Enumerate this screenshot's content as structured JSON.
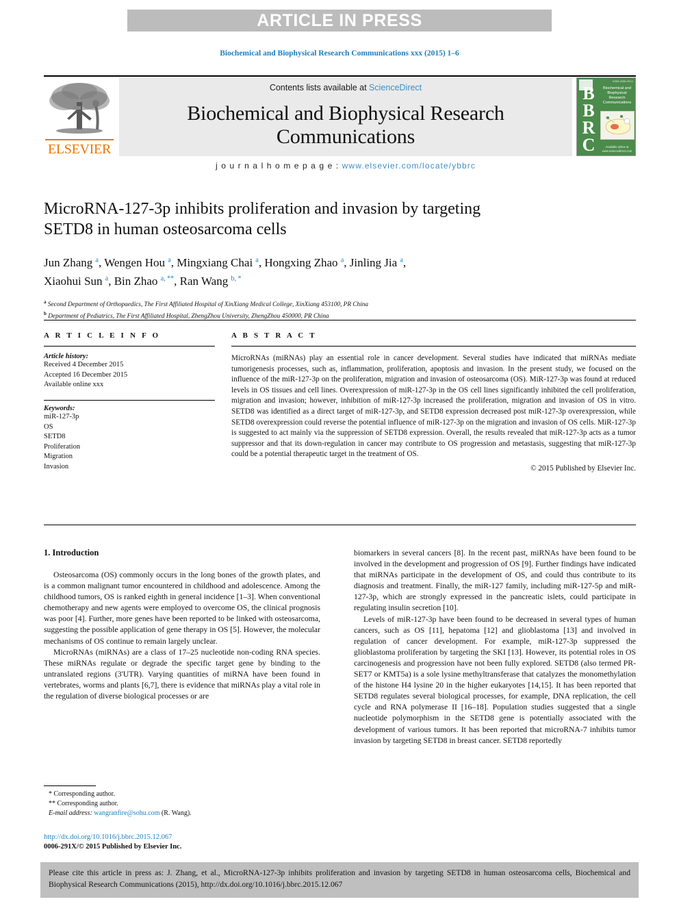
{
  "banner": {
    "text": "ARTICLE IN PRESS"
  },
  "running_head": {
    "text": "Biochemical and Biophysical Research Communications xxx (2015) 1–6"
  },
  "masthead": {
    "contents_prefix": "Contents lists available at ",
    "sciencedirect": "ScienceDirect",
    "journal_title": "Biochemical and Biophysical Research Communications",
    "homepage_label": "j o u r n a l   h o m e p a g e :   ",
    "homepage_url": "www.elsevier.com/locate/ybbrc",
    "elsevier_wordmark": "ELSEVIER",
    "cover": {
      "letters": "B\nB\nR\nC",
      "title_lines": "Biochemical and Biophysical Research Communications",
      "top_right": "ISSN 0006-291X",
      "bottom": "Available online at www.sciencedirect.com"
    }
  },
  "article": {
    "title": "MicroRNA-127-3p inhibits proliferation and invasion by targeting SETD8 in human osteosarcoma cells",
    "authors_line1": "Jun Zhang a, Wengen Hou a, Mingxiang Chai a, Hongxing Zhao a, Jinling Jia a,",
    "authors_line2": "Xiaohui Sun a, Bin Zhao a, **, Ran Wang b, *",
    "affiliation_a": "Second Department of Orthopaedics, The First Affiliated Hospital of XinXiang Medical College, XinXiang 453100, PR China",
    "affiliation_b": "Department of Pediatrics, The First Affiliated Hospital, ZhengZhou University, ZhengZhou 450000, PR China"
  },
  "article_info": {
    "heading": "A R T I C L E   I N F O",
    "history_label": "Article history:",
    "received": "Received 4 December 2015",
    "accepted": "Accepted 16 December 2015",
    "available": "Available online xxx",
    "keywords_label": "Keywords:",
    "keywords": [
      "miR-127-3p",
      "OS",
      "SETD8",
      "Proliferation",
      "Migration",
      "Invasion"
    ]
  },
  "abstract": {
    "heading": "A B S T R A C T",
    "text": "MicroRNAs (miRNAs) play an essential role in cancer development. Several studies have indicated that miRNAs mediate tumorigenesis processes, such as, inflammation, proliferation, apoptosis and invasion. In the present study, we focused on the influence of the miR-127-3p on the proliferation, migration and invasion of osteosarcoma (OS). MiR-127-3p was found at reduced levels in OS tissues and cell lines. Overexpression of miR-127-3p in the OS cell lines significantly inhibited the cell proliferation, migration and invasion; however, inhibition of miR-127-3p increased the proliferation, migration and invasion of OS in vitro. SETD8 was identified as a direct target of miR-127-3p, and SETD8 expression decreased post miR-127-3p overexpression, while SETD8 overexpression could reverse the potential influence of miR-127-3p on the migration and invasion of OS cells. MiR-127-3p is suggested to act mainly via the suppression of SETD8 expression. Overall, the results revealed that miR-127-3p acts as a tumor suppressor and that its down-regulation in cancer may contribute to OS progression and metastasis, suggesting that miR-127-3p could be a potential therapeutic target in the treatment of OS.",
    "copyright": "© 2015 Published by Elsevier Inc."
  },
  "introduction": {
    "heading": "1.  Introduction",
    "left_paragraphs": [
      "Osteosarcoma (OS) commonly occurs in the long bones of the growth plates, and is a common malignant tumor encountered in childhood and adolescence. Among the childhood tumors, OS is ranked eighth in general incidence [1–3]. When conventional chemotherapy and new agents were employed to overcome OS, the clinical prognosis was poor [4]. Further, more genes have been reported to be linked with osteosarcoma, suggesting the possible application of gene therapy in OS [5]. However, the molecular mechanisms of OS continue to remain largely unclear.",
      "MicroRNAs (miRNAs) are a class of 17–25 nucleotide non-coding RNA species. These miRNAs regulate or degrade the specific target gene by binding to the untranslated regions (3'UTR). Varying quantities of miRNA have been found in vertebrates, worms and plants [6,7], there is evidence that miRNAs play a vital role in the regulation of diverse biological processes or are"
    ],
    "right_paragraphs": [
      "biomarkers in several cancers [8]. In the recent past, miRNAs have been found to be involved in the development and progression of OS [9]. Further findings have indicated that miRNAs participate in the development of OS, and could thus contribute to its diagnosis and treatment. Finally, the miR-127 family, including miR-127-5p and miR-127-3p, which are strongly expressed in the pancreatic islets, could participate in regulating insulin secretion [10].",
      "Levels of miR-127-3p have been found to be decreased in several types of human cancers, such as OS [11], hepatoma [12] and glioblastoma [13] and involved in regulation of cancer development. For example, miR-127-3p suppressed the glioblastoma proliferation by targeting the SKI [13]. However, its potential roles in OS carcinogenesis and progression have not been fully explored. SETD8 (also termed PR-SET7 or KMT5a) is a sole lysine methyltransferase that catalyzes the monomethylation of the histone H4 lysine 20 in the higher eukaryotes [14,15]. It has been reported that SETD8 regulates several biological processes, for example, DNA replication, the cell cycle and RNA polymerase II [16–18]. Population studies suggested that a single nucleotide polymorphism in the SETD8 gene is potentially associated with the development of various tumors. It has been reported that microRNA-7 inhibits tumor invasion by targeting SETD8 in breast cancer. SETD8 reportedly"
    ]
  },
  "footnotes": {
    "corresponding_1": "*  Corresponding author.",
    "corresponding_2": "**  Corresponding author.",
    "email_label": "E-mail address: ",
    "email": "wangranfire@sohu.com",
    "email_suffix": " (R. Wang)."
  },
  "doi_block": {
    "doi_url": "http://dx.doi.org/10.1016/j.bbrc.2015.12.067",
    "issn_line": "0006-291X/© 2015 Published by Elsevier Inc."
  },
  "cite_box": {
    "text": "Please cite this article in press as: J. Zhang, et al., MicroRNA-127-3p inhibits proliferation and invasion by targeting SETD8 in human osteosarcoma cells, Biochemical and Biophysical Research Communications (2015), http://dx.doi.org/10.1016/j.bbrc.2015.12.067"
  },
  "colors": {
    "link_blue": "#1b7fbe",
    "banner_gray": "#bcbcbc",
    "masthead_gray": "#eaeaea",
    "cite_gray": "#bfbfbf",
    "elsevier_orange": "#ea7600",
    "cover_green": "#4b8b4b"
  }
}
